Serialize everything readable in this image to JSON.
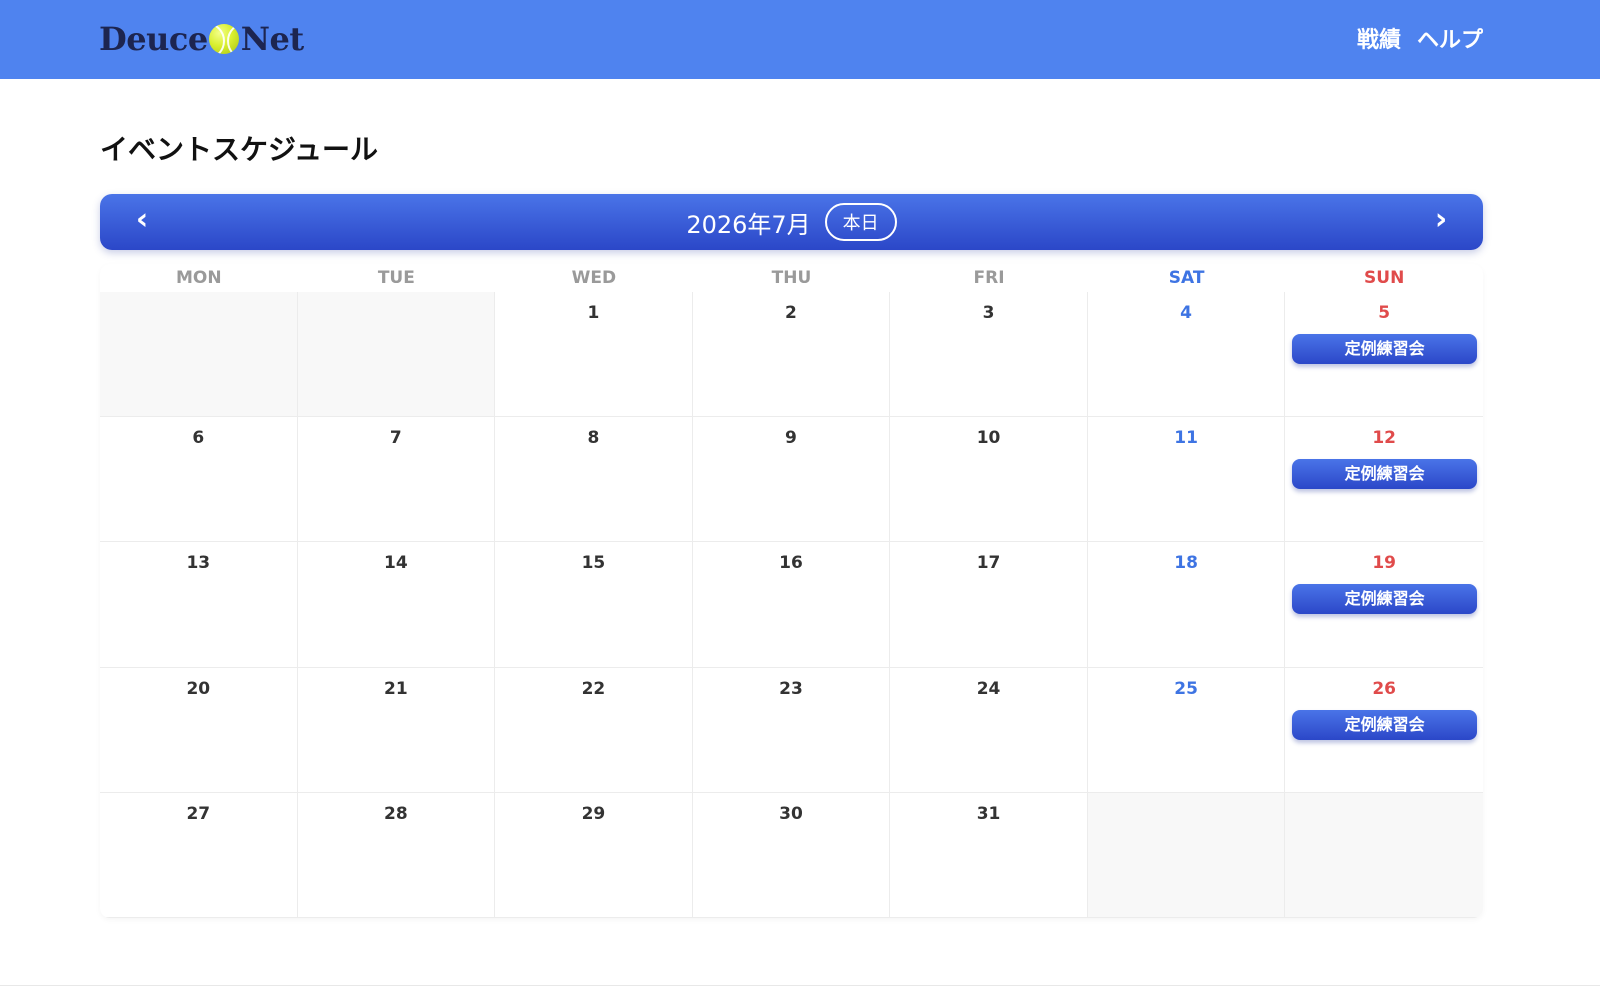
{
  "header": {
    "logo_left": "Deuce",
    "logo_right": "Net",
    "nav": [
      "戦績",
      "ヘルプ"
    ],
    "colors": {
      "bar": "#4f83ef"
    }
  },
  "page": {
    "title": "イベントスケジュール"
  },
  "calendar": {
    "month_label": "2026年7月",
    "today_label": "本日",
    "prev_icon": "chevron-left-icon",
    "next_icon": "chevron-right-icon",
    "weekdays": [
      "MON",
      "TUE",
      "WED",
      "THU",
      "FRI",
      "SAT",
      "SUN"
    ],
    "weeks": [
      [
        null,
        null,
        1,
        2,
        3,
        4,
        5
      ],
      [
        6,
        7,
        8,
        9,
        10,
        11,
        12
      ],
      [
        13,
        14,
        15,
        16,
        17,
        18,
        19
      ],
      [
        20,
        21,
        22,
        23,
        24,
        25,
        26
      ],
      [
        27,
        28,
        29,
        30,
        31,
        null,
        null
      ]
    ],
    "events": [
      {
        "day": 5,
        "title": "定例練習会"
      },
      {
        "day": 12,
        "title": "定例練習会"
      },
      {
        "day": 19,
        "title": "定例練習会"
      },
      {
        "day": 26,
        "title": "定例練習会"
      }
    ],
    "colors": {
      "accent": "#2b47c8",
      "saturday": "#3e74e3",
      "sunday": "#e04b4b"
    }
  }
}
